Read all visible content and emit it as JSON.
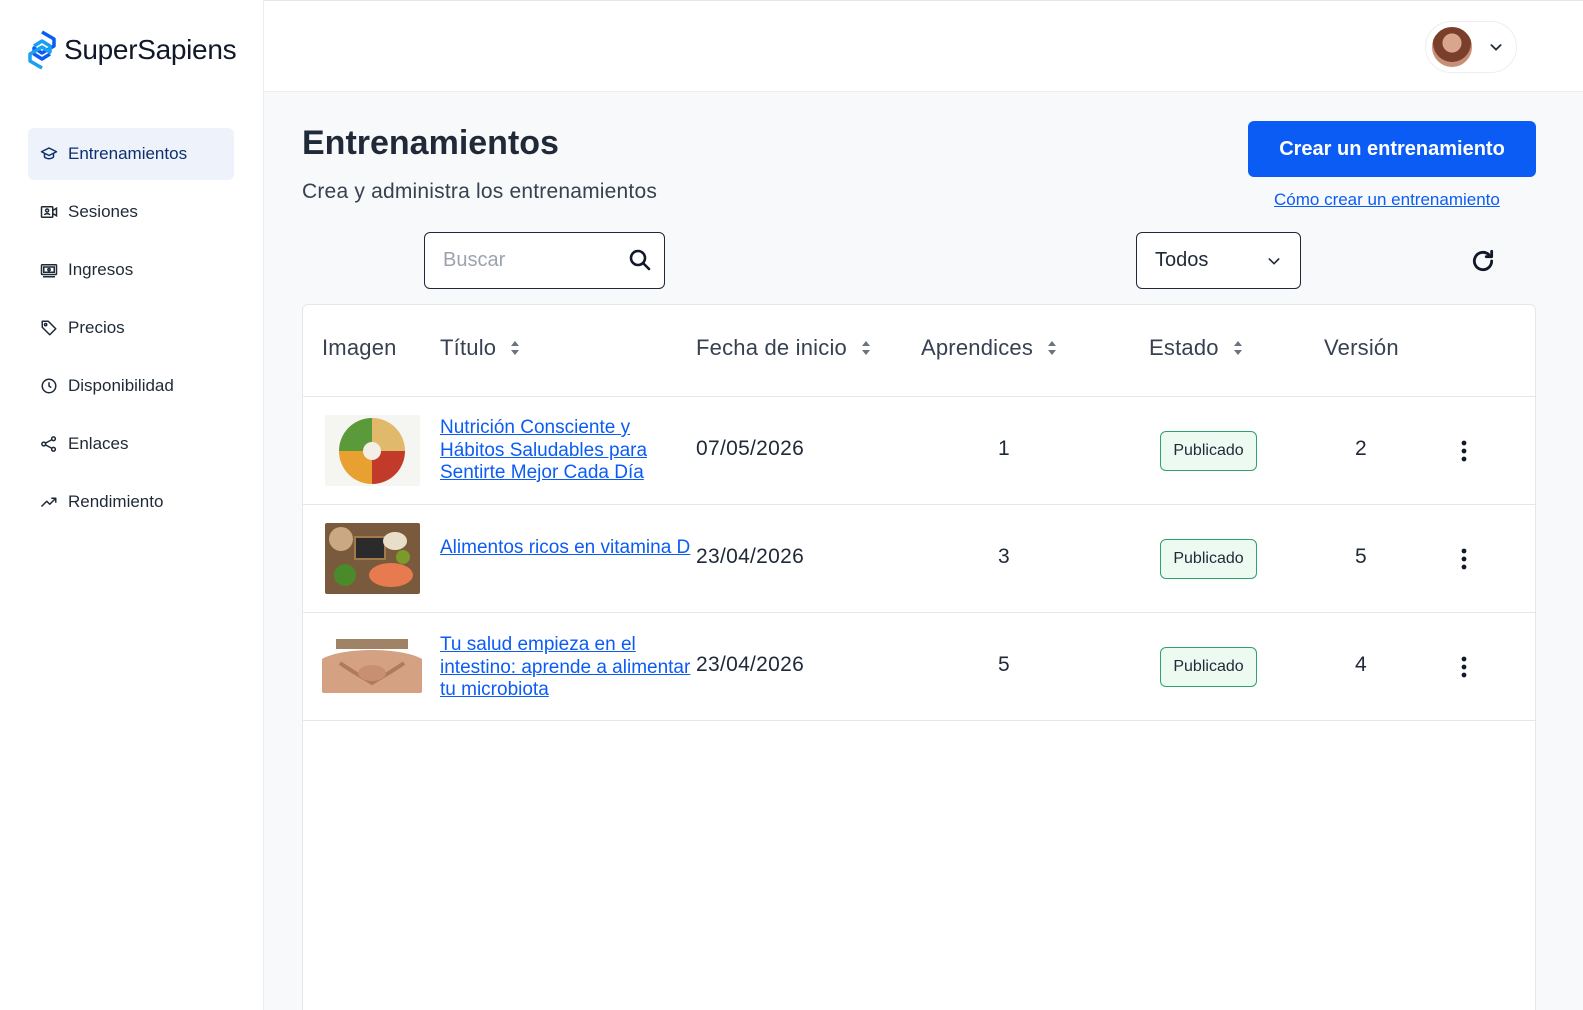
{
  "brand": {
    "name": "SuperSapiens",
    "accent": "#0b5cf5"
  },
  "sidebar": {
    "items": [
      {
        "label": "Entrenamientos",
        "icon": "graduation-cap-icon",
        "active": true
      },
      {
        "label": "Sesiones",
        "icon": "video-icon",
        "active": false
      },
      {
        "label": "Ingresos",
        "icon": "money-icon",
        "active": false
      },
      {
        "label": "Precios",
        "icon": "tag-icon",
        "active": false
      },
      {
        "label": "Disponibilidad",
        "icon": "clock-icon",
        "active": false
      },
      {
        "label": "Enlaces",
        "icon": "share-icon",
        "active": false
      },
      {
        "label": "Rendimiento",
        "icon": "trend-up-icon",
        "active": false
      }
    ]
  },
  "header": {
    "user_icon": "avatar",
    "menu_icon": "chevron-down-icon"
  },
  "page": {
    "title": "Entrenamientos",
    "subtitle": "Crea y administra los entrenamientos",
    "create_button": "Crear un entrenamiento",
    "help_link": "Cómo crear un entrenamiento"
  },
  "filters": {
    "search_placeholder": "Buscar",
    "search_value": "",
    "status_selected": "Todos"
  },
  "table": {
    "columns": [
      "Imagen",
      "Título",
      "Fecha de inicio",
      "Aprendices",
      "Estado",
      "Versión"
    ],
    "rows": [
      {
        "title": "Nutrición Consciente y Hábitos Saludables para Sentirte Mejor Cada Día",
        "start_date": "07/05/2026",
        "learners": "1",
        "status": "Publicado",
        "version": "2",
        "image": "healthy-food-plate"
      },
      {
        "title": "Alimentos ricos en vitamina D",
        "start_date": "23/04/2026",
        "learners": "3",
        "status": "Publicado",
        "version": "5",
        "image": "vitamin-d-foods"
      },
      {
        "title": "Tu salud empieza en el intestino: aprende a alimentar tu microbiota",
        "start_date": "23/04/2026",
        "learners": "5",
        "status": "Publicado",
        "version": "4",
        "image": "hands-on-belly"
      }
    ]
  }
}
